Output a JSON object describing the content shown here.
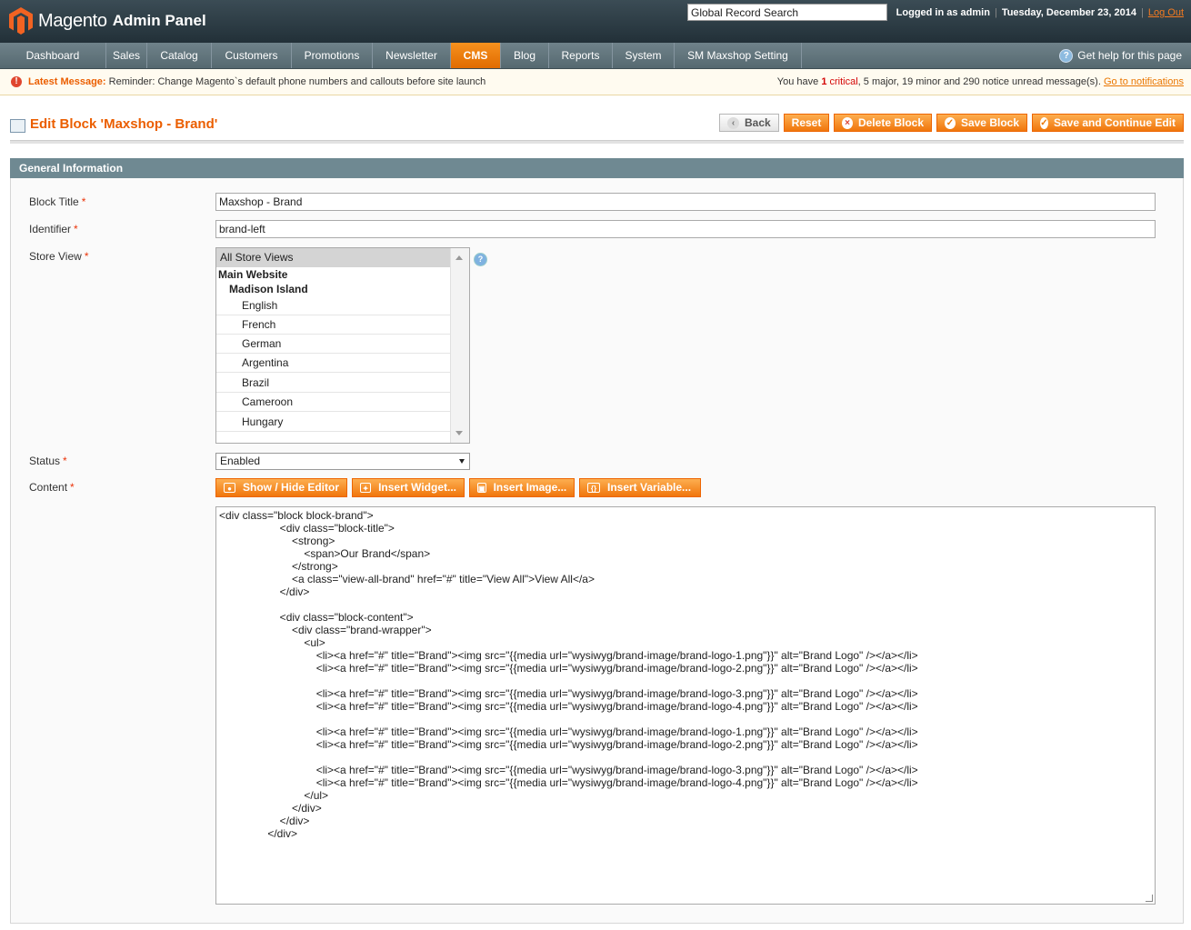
{
  "header": {
    "brand": "Magento",
    "brand_sub": "Admin Panel",
    "search_placeholder": "Global Record Search",
    "logged_in": "Logged in as admin",
    "date": "Tuesday, December 23, 2014",
    "logout": "Log Out"
  },
  "nav": {
    "items": [
      "Dashboard",
      "Sales",
      "Catalog",
      "Customers",
      "Promotions",
      "Newsletter",
      "CMS",
      "Blog",
      "Reports",
      "System",
      "SM Maxshop Setting"
    ],
    "active": "CMS",
    "help": "Get help for this page"
  },
  "message": {
    "label": "Latest Message:",
    "text": "Reminder: Change Magento`s default phone numbers and callouts before site launch",
    "right_prefix": "You have",
    "critical_count": "1",
    "critical_word": "critical",
    "rest": ", 5 major, 19 minor and 290 notice unread message(s).",
    "link": "Go to notifications"
  },
  "page": {
    "title": "Edit Block 'Maxshop - Brand'",
    "buttons": {
      "back": "Back",
      "reset": "Reset",
      "delete": "Delete Block",
      "save": "Save Block",
      "save_continue": "Save and Continue Edit"
    }
  },
  "section": {
    "title": "General Information"
  },
  "form": {
    "block_title_label": "Block Title",
    "block_title_value": "Maxshop - Brand",
    "identifier_label": "Identifier",
    "identifier_value": "brand-left",
    "store_view_label": "Store View",
    "store_options": [
      "All Store Views",
      "Main Website",
      "Madison Island",
      "English",
      "French",
      "German",
      "Argentina",
      "Brazil",
      "Cameroon",
      "Hungary"
    ],
    "status_label": "Status",
    "status_value": "Enabled",
    "content_label": "Content",
    "editor_buttons": [
      "Show / Hide Editor",
      "Insert Widget...",
      "Insert Image...",
      "Insert Variable..."
    ],
    "content": "<div class=\"block block-brand\">\n                    <div class=\"block-title\">\n                        <strong>\n                            <span>Our Brand</span>\n                        </strong>\n                        <a class=\"view-all-brand\" href=\"#\" title=\"View All\">View All</a>\n                    </div>\n\n                    <div class=\"block-content\">\n                        <div class=\"brand-wrapper\">\n                            <ul>\n                                <li><a href=\"#\" title=\"Brand\"><img src=\"{{media url=\"wysiwyg/brand-image/brand-logo-1.png\"}}\" alt=\"Brand Logo\" /></a></li>\n                                <li><a href=\"#\" title=\"Brand\"><img src=\"{{media url=\"wysiwyg/brand-image/brand-logo-2.png\"}}\" alt=\"Brand Logo\" /></a></li>\n\n                                <li><a href=\"#\" title=\"Brand\"><img src=\"{{media url=\"wysiwyg/brand-image/brand-logo-3.png\"}}\" alt=\"Brand Logo\" /></a></li>\n                                <li><a href=\"#\" title=\"Brand\"><img src=\"{{media url=\"wysiwyg/brand-image/brand-logo-4.png\"}}\" alt=\"Brand Logo\" /></a></li>\n\n                                <li><a href=\"#\" title=\"Brand\"><img src=\"{{media url=\"wysiwyg/brand-image/brand-logo-1.png\"}}\" alt=\"Brand Logo\" /></a></li>\n                                <li><a href=\"#\" title=\"Brand\"><img src=\"{{media url=\"wysiwyg/brand-image/brand-logo-2.png\"}}\" alt=\"Brand Logo\" /></a></li>\n\n                                <li><a href=\"#\" title=\"Brand\"><img src=\"{{media url=\"wysiwyg/brand-image/brand-logo-3.png\"}}\" alt=\"Brand Logo\" /></a></li>\n                                <li><a href=\"#\" title=\"Brand\"><img src=\"{{media url=\"wysiwyg/brand-image/brand-logo-4.png\"}}\" alt=\"Brand Logo\" /></a></li>\n                            </ul>\n                        </div>\n                    </div>\n                </div>"
  },
  "colors": {
    "accent": "#ea7601",
    "header_bg": "#2c3d46",
    "section_head": "#6f8992"
  }
}
